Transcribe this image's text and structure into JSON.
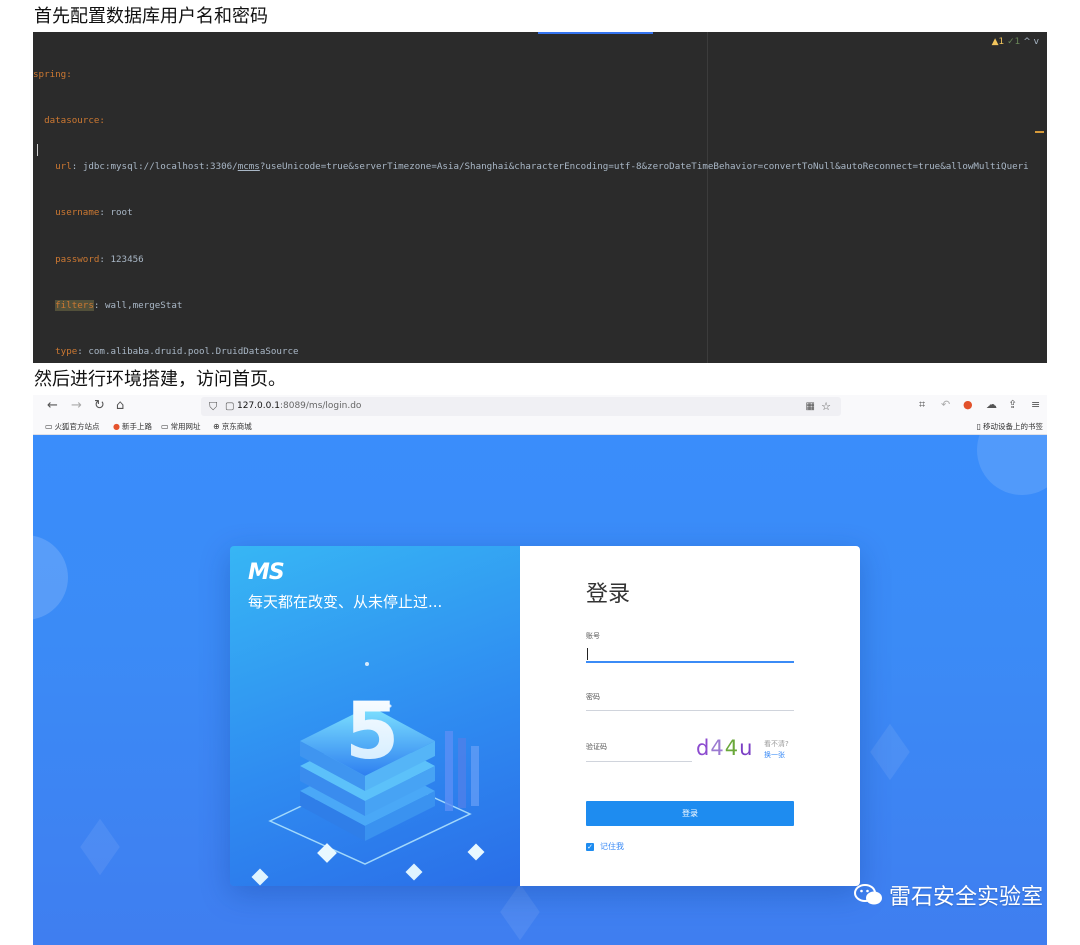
{
  "headings": {
    "step1": "首先配置数据库用户名和密码",
    "step2": "然后进行环境搭建，访问首页。"
  },
  "ide": {
    "status": {
      "warnings": "▲1",
      "checks": "✓1",
      "arrows": "^ v"
    },
    "lines": {
      "l1_key": "spring:",
      "l2_key": "datasource:",
      "l3_key": "url",
      "l3_val_a": ": jdbc:mysql://localhost:3306/",
      "l3_val_db": "mcms",
      "l3_val_b": "?useUnicode=true&serverTimezone=Asia/Shanghai&characterEncoding=utf-8&zeroDateTimeBehavior=convertToNull&autoReconnect=true&allowMultiQueri",
      "l4_key": "username",
      "l4_val": ": root",
      "l5_key": "password",
      "l5_val": ": 123456",
      "l6_key": "filters",
      "l6_val": ": wall,mergeStat",
      "l7_key": "type",
      "l7_val": ": com.alibaba.druid.pool.DruidDataSource"
    }
  },
  "browser": {
    "url_host": "127.0.0.1",
    "url_path": ":8089/ms/login.do",
    "bookmarks": [
      "火狐官方站点",
      "新手上路",
      "常用网址",
      "京东商城"
    ],
    "mobile_bookmarks": "移动设备上的书签"
  },
  "login": {
    "logo": "MS",
    "slogan": "每天都在改变、从未停止过...",
    "big_number": "5",
    "title": "登录",
    "account_label": "账号",
    "password_label": "密码",
    "captcha_label": "验证码",
    "captcha_chars": [
      "d",
      "4",
      "4",
      "u"
    ],
    "captcha_hint_1": "看不清?",
    "captcha_hint_2": "换一张",
    "login_button": "登录",
    "remember_me": "记住我"
  },
  "watermark": "雷石安全实验室",
  "colors": {
    "accent": "#1e8cf0",
    "ide_bg": "#2b2b2b",
    "yaml_key": "#cc7832",
    "page_bg": "#3b8bf6"
  }
}
